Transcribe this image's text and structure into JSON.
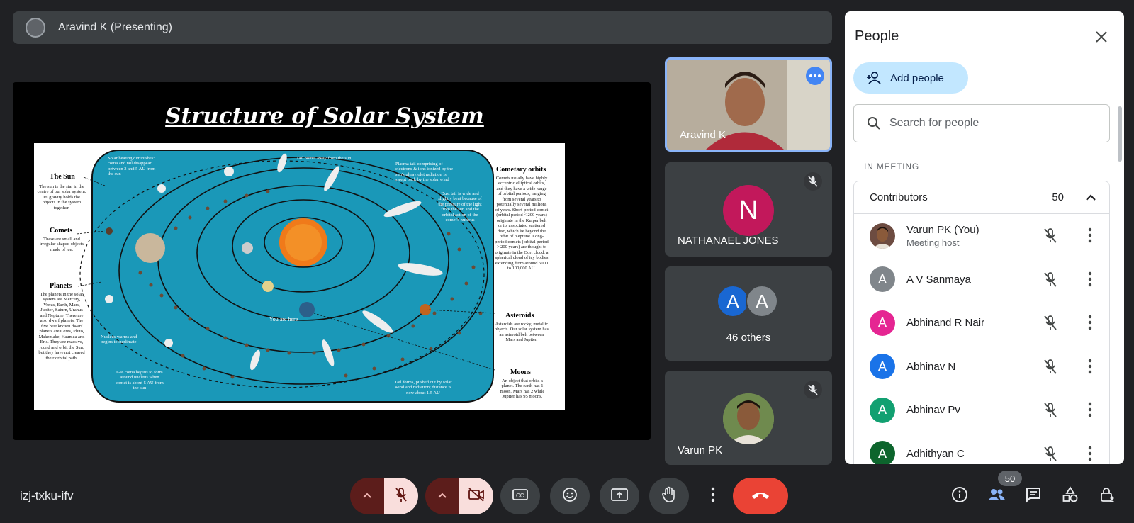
{
  "presenter_bar": {
    "label": "Aravind K (Presenting)"
  },
  "slide": {
    "title": "Structure of Solar System",
    "labels": {
      "sun": "The Sun",
      "sun_text": "The sun is the star in the centre of our solar system. Its gravity holds the objects in the system together.",
      "comets": "Comets",
      "comets_text": "These are small and irregular shaped objects made of ice.",
      "planets": "Planets",
      "planets_text": "The planets in the solar system are Mercury, Venus, Earth, Mars, Jupiter, Saturn, Uranus and Neptune. There are also dwarf planets. The five best known dwarf planets are Ceres, Pluto, Makemake, Haumea and Eris. They are massive, round and orbit the Sun, but they have not cleared their orbital path.",
      "cometary": "Cometary orbits",
      "cometary_text": "Comets usually have highly eccentric elliptical orbits, and they have a wide range of orbital periods, ranging from several years to potentially several millions of years. Short-period comet (orbital period < 200 years) originate in the Kuiper belt or its associated scattered disc, which lie beyond the orbit of Neptune. Long-period comets (orbital period > 200 years) are thought to originate in the Oort cloud, a spherical cloud of icy bodies extending from around 5000 to 100,000 AU.",
      "asteroids": "Asteroids",
      "asteroids_text": "Asteroids are rocky, metallic objects. Our solar system has an asteroid belt between Mars and Jupiter.",
      "moons": "Moons",
      "moons_text": "An object that orbits a planet. The earth has 1 moon, Mars has 2 while Jupiter has 95 moons.",
      "you_are_here": "You are here",
      "solar_heating": "Solar heating diminishes: coma and tail disappear between 3 and 5 AU from the sun",
      "tail_points": "Tail points away from the sun",
      "plasma_tail": "Plasma tail comprising of electrons & ions ionized by the sun's ultraviolet radiation is swept back by the solar wind",
      "dust_tail": "Dust tail is wide and slightly bent because of the pressure of the light from the sun and the orbital action of the comet's nucleus",
      "nucleus_warms": "Nucleus warms and begins to sublimate",
      "gas_coma": "Gas coma begins to form around nucleus when comet is about 5 AU from the sun",
      "tail_forms": "Tail forms, pushed out by solar wind and radiation; distance is now about 1.5 AU"
    }
  },
  "tiles": [
    {
      "name": "Aravind K"
    },
    {
      "name": "NATHANAEL JONES",
      "initial": "N",
      "color": "#c2185b"
    },
    {
      "label": "46 others",
      "initials": [
        "A",
        "A"
      ],
      "colors": [
        "#1967d2",
        "#80868b"
      ]
    },
    {
      "name": "Varun PK"
    }
  ],
  "panel": {
    "title": "People",
    "add_people": "Add people",
    "search_placeholder": "Search for people",
    "in_meeting": "IN MEETING",
    "contributors_label": "Contributors",
    "contributors_count": "50",
    "people": [
      {
        "name": "Varun PK (You)",
        "sub": "Meeting host",
        "initial": "",
        "color": "#6d4c41"
      },
      {
        "name": "A V Sanmaya",
        "initial": "A",
        "color": "#80868b"
      },
      {
        "name": "Abhinand R Nair",
        "initial": "A",
        "color": "#e52592"
      },
      {
        "name": "Abhinav N",
        "initial": "A",
        "color": "#1a73e8"
      },
      {
        "name": "Abhinav Pv",
        "initial": "A",
        "color": "#12a071"
      },
      {
        "name": "Adhithyan C",
        "initial": "A",
        "color": "#0d652d"
      }
    ]
  },
  "bottom": {
    "meeting_code": "izj-txku-ifv",
    "people_count": "50"
  }
}
